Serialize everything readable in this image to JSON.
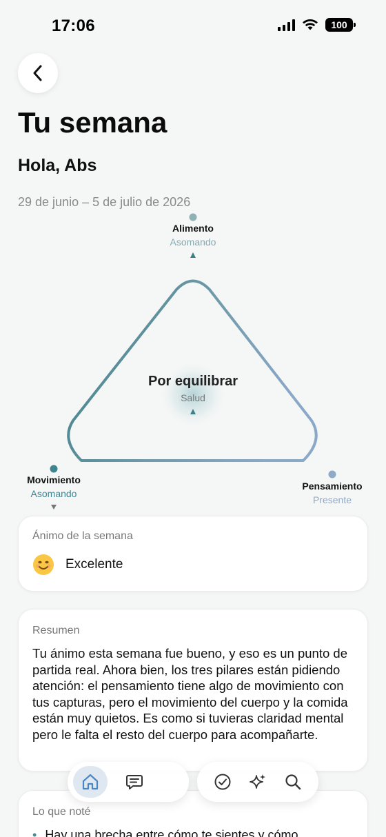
{
  "status": {
    "time": "17:06",
    "battery": "100"
  },
  "header": {
    "back_icon": "chevron-left-icon",
    "title": "Tu semana",
    "greeting": "Hola, Abs",
    "date_range": "29 de junio – 5 de julio de 2026"
  },
  "triangle": {
    "center_title": "Por equilibrar",
    "center_subtitle": "Salud",
    "vertices": {
      "top": {
        "name": "Alimento",
        "state": "Asomando"
      },
      "left": {
        "name": "Movimiento",
        "state": "Asomando"
      },
      "right": {
        "name": "Pensamiento",
        "state": "Presente"
      }
    },
    "colors": {
      "teal": "#3e7f86",
      "blue": "#8aa8c8",
      "top_dot": "#8fb1b3",
      "left_dot": "#3f8590",
      "right_dot": "#8fa9c8"
    }
  },
  "mood": {
    "label": "Ánimo de la semana",
    "value": "Excelente",
    "icon": "smiling-face-icon"
  },
  "summary": {
    "label": "Resumen",
    "text": "Tu ánimo esta semana fue bueno, y eso es un punto de partida real. Ahora bien, los tres pilares están pidiendo atención: el pensamiento tiene algo de movimiento con tus capturas, pero el movimiento del cuerpo y la comida están muy quietos. Es como si tuvieras claridad mental pero le falta el resto del cuerpo para acompañarte."
  },
  "notes": {
    "label": "Lo que noté",
    "items": [
      "Hay una brecha entre cómo te sientes y cómo"
    ]
  },
  "tabbar": {
    "tabs": [
      "home-icon",
      "chat-icon",
      "check-icon",
      "sparkle-icon",
      "search-icon"
    ]
  }
}
